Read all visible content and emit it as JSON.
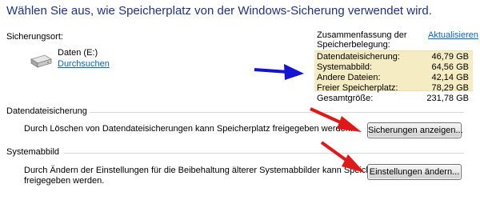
{
  "header": {
    "title": "Wählen Sie aus, wie Speicherplatz von der Windows-Sicherung verwendet wird."
  },
  "location": {
    "label": "Sicherungsort:",
    "drive_name": "Daten (E:)",
    "browse_link": "Durchsuchen"
  },
  "summary": {
    "heading_line1": "Zusammenfassung der",
    "heading_line2": "Speicherbelegung:",
    "refresh_link": "Aktualisieren",
    "rows": [
      {
        "label": "Datendateisicherung:",
        "value": "46,79 GB"
      },
      {
        "label": "Systemabbild:",
        "value": "64,56 GB"
      },
      {
        "label": "Andere Dateien:",
        "value": "42,14 GB"
      },
      {
        "label": "Freier Speicherplatz:",
        "value": "78,29 GB"
      },
      {
        "label": "Gesamtgröße:",
        "value": "231,78 GB"
      }
    ],
    "highlight_color": "#f6ecc4"
  },
  "data_backup": {
    "heading": "Datendateisicherung",
    "description": "Durch Löschen von Datendateisicherungen kann Speicherplatz freigegeben werden.",
    "button_label": "Sicherungen anzeigen..."
  },
  "system_image": {
    "heading": "Systemabbild",
    "description_line1": "Durch Ändern der Einstellungen für die Beibehaltung älterer Systemabbilder kann Speicherplatz",
    "description_line2": "freigegeben werden.",
    "button_label": "Einstellungen ändern..."
  },
  "annotations": {
    "blue_arrow_color": "#1414d2",
    "red_arrow_color": "#e01818"
  }
}
